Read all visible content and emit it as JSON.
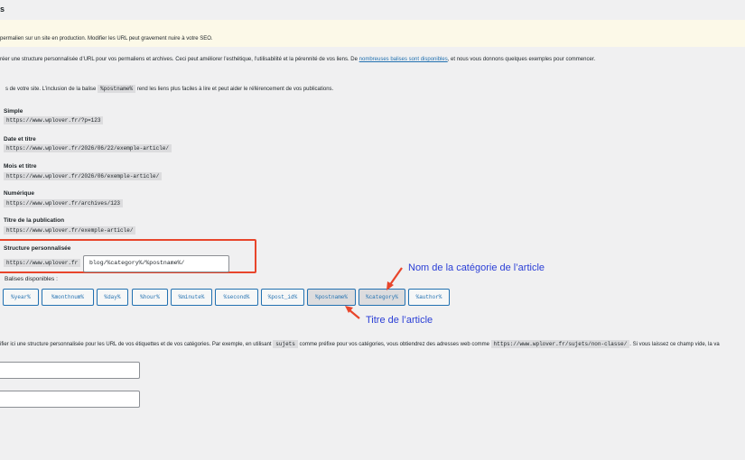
{
  "heading": "s",
  "notice": "permalien sur un site en production. Modifier les URL peut gravement nuire à votre SEO.",
  "intro": {
    "before": "réer une structure personnalisée d’URL pour vos permaliens et archives. Ceci peut améliorer l’esthétique, l’utilisabilité et la pérennité de vos liens. De ",
    "link": "nombreuses balises sont disponibles",
    "after": ", et nous vous donnons quelques exemples pour commencer."
  },
  "note": {
    "before": "s de votre site. L’inclusion de la balise ",
    "code": "%postname%",
    "after": " rend les liens plus faciles à lire et peut aider le référencement de vos publications."
  },
  "options": [
    {
      "label": "Simple",
      "example": "https://www.wplover.fr/?p=123"
    },
    {
      "label": "Date et titre",
      "example": "https://www.wplover.fr/2026/06/22/exemple-article/"
    },
    {
      "label": "Mois et titre",
      "example": "https://www.wplover.fr/2026/06/exemple-article/"
    },
    {
      "label": "Numérique",
      "example": "https://www.wplover.fr/archives/123"
    },
    {
      "label": "Titre de la publication",
      "example": "https://www.wplover.fr/exemple-article/"
    }
  ],
  "custom": {
    "label": "Structure personnalisée",
    "prefix": "https://www.wplover.fr",
    "value": "blog/%category%/%postname%/"
  },
  "tags_label": "Balises disponibles :",
  "tags": [
    "%year%",
    "%monthnum%",
    "%day%",
    "%hour%",
    "%minute%",
    "%second%",
    "%post_id%",
    "%postname%",
    "%category%",
    "%author%"
  ],
  "annotations": {
    "category": "Nom de la catégorie de l’article",
    "title": "Titre de l’article"
  },
  "optional": {
    "before": "ifier ici une structure personnalisée pour les URL de vos étiquettes et de vos catégories. Par exemple, en utilisant ",
    "code1": "sujets",
    "middle": " comme préfixe pour vos catégories, vous obtiendrez des adresses web comme ",
    "code2": "https://www.wplover.fr/sujets/non-classe/",
    "after": ". Si vous laissez ce champ vide, la va"
  },
  "colors": {
    "accent": "#2271b1",
    "annotation": "#2a3ed6",
    "highlight": "#e8452b"
  }
}
